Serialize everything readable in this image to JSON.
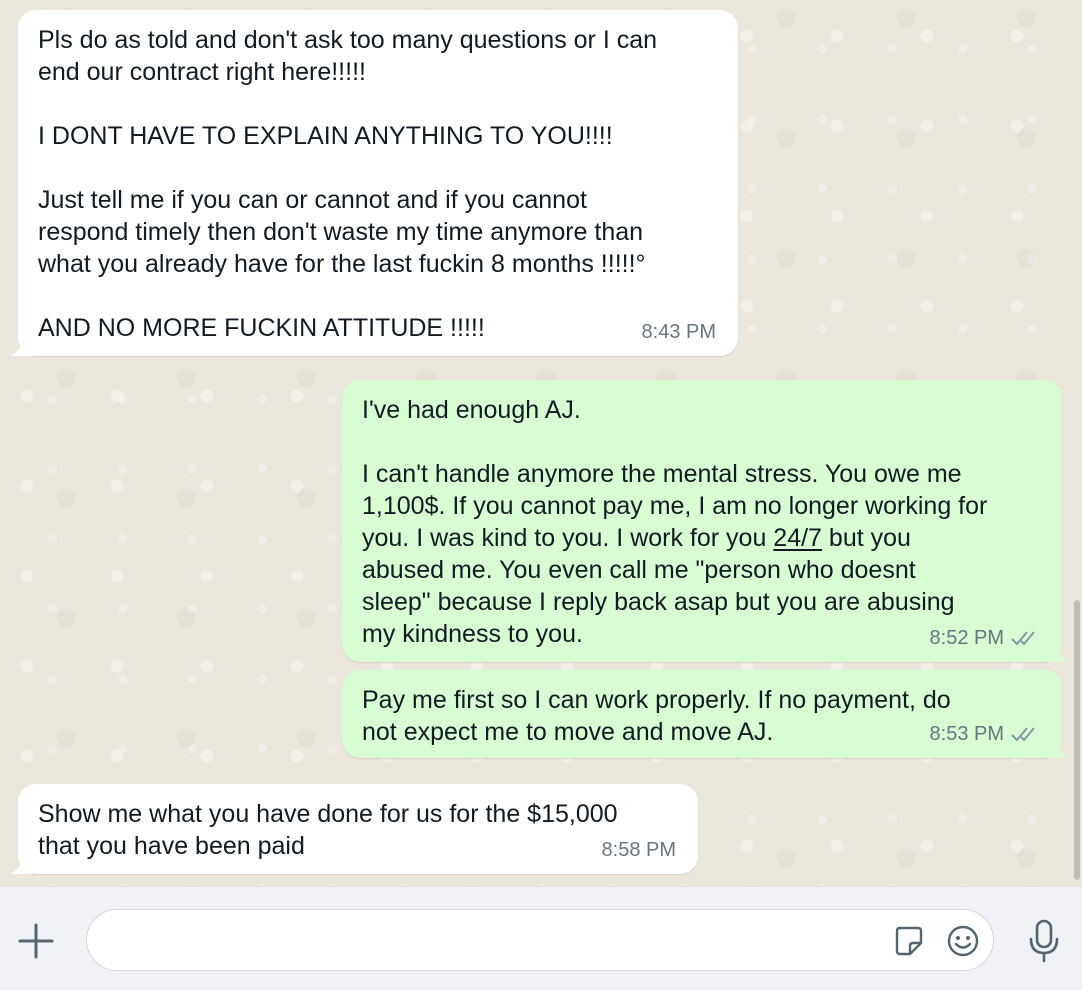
{
  "messages": [
    {
      "direction": "incoming",
      "text": "Pls do as told and don't ask too many questions or I can\nend our contract right here!!!!!\n\nI DONT HAVE TO EXPLAIN ANYTHING TO YOU!!!!\n\nJust tell me if you can or cannot and if you cannot\nrespond timely then don't waste my time anymore than\nwhat you already have for the last fuckin 8 months !!!!!°\n\nAND NO MORE FUCKIN ATTITUDE !!!!!",
      "time": "8:43 PM"
    },
    {
      "direction": "outgoing",
      "text_before": "I've had enough AJ.\n\nI can't handle anymore the mental stress. You owe me\n1,100$. If you cannot pay me, I am no longer working for\nyou. I was kind to you. I work for you ",
      "text_link": "24/7",
      "text_after": " but you\nabused me. You even call me \"person who doesnt\nsleep\" because I reply back asap but you are abusing\nmy kindness to you.",
      "time": "8:52 PM",
      "status": "read"
    },
    {
      "direction": "outgoing",
      "text": "Pay me first so I can work properly. If no payment, do\nnot expect me to move and move AJ.",
      "time": "8:53 PM",
      "status": "read"
    },
    {
      "direction": "incoming",
      "text": "Show me what you have done for us for the $15,000\nthat you have been paid",
      "time": "8:58 PM"
    }
  ],
  "composer": {
    "placeholder": "",
    "icons": [
      "plus-icon",
      "sticker-icon",
      "emoji-icon",
      "microphone-icon"
    ]
  },
  "colors": {
    "incoming_bubble": "#ffffff",
    "outgoing_bubble": "#d9fdd3",
    "chat_background": "#ece7dd",
    "meta_text": "#667781"
  }
}
